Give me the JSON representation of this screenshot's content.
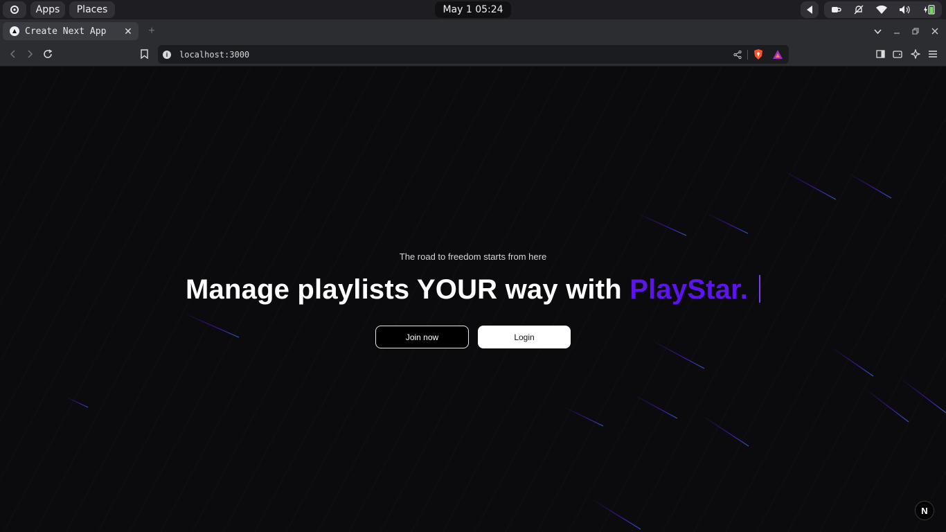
{
  "system_bar": {
    "apps_label": "Apps",
    "places_label": "Places",
    "clock": "May 1 05:24"
  },
  "browser": {
    "tab_title": "Create Next App",
    "url": "localhost:3000"
  },
  "page": {
    "subtitle": "The road to freedom starts from here",
    "headline_prefix": "Manage playlists YOUR way with ",
    "headline_brand": "PlayStar.",
    "join_label": "Join now",
    "login_label": "Login",
    "brand_color": "#5d14ec",
    "dev_badge": "N"
  }
}
